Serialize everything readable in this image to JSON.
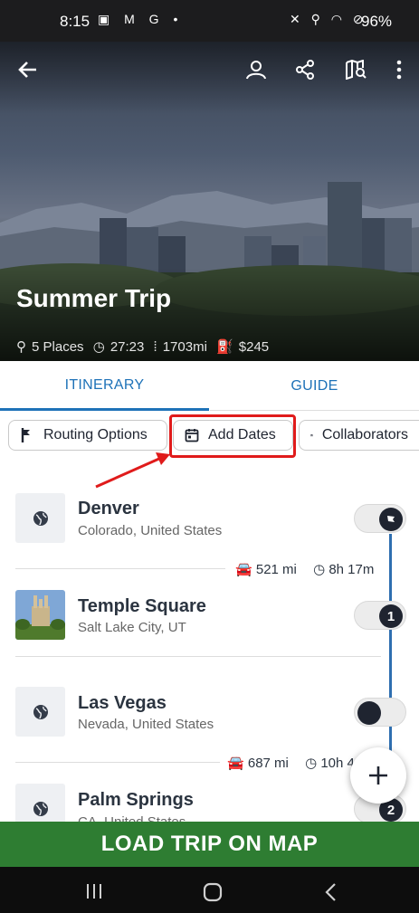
{
  "status_bar": {
    "time": "8:15",
    "left_icons": "▣ M G •",
    "right_icons": "✕ ⚲ ◠ ⊘",
    "battery": "96%"
  },
  "header": {
    "title": "Summer Trip",
    "stats": {
      "places": "5 Places",
      "duration": "27:23",
      "distance": "1703mi",
      "cost": "$245"
    }
  },
  "tabs": [
    {
      "label": "ITINERARY",
      "active": true
    },
    {
      "label": "GUIDE",
      "active": false
    }
  ],
  "chips": {
    "routing": "Routing Options",
    "dates": "Add Dates",
    "collab": "Collaborators"
  },
  "stops": [
    {
      "name": "Denver",
      "sub": "Colorado, United States",
      "marker": "flag"
    },
    {
      "name": "Temple Square",
      "sub": "Salt Lake City, UT",
      "marker": "1"
    },
    {
      "name": "Las Vegas",
      "sub": "Nevada, United States",
      "marker": ""
    },
    {
      "name": "Palm Springs",
      "sub": "CA, United States",
      "marker": "2"
    }
  ],
  "legs": [
    {
      "distance": "521 mi",
      "time": "8h 17m"
    },
    {
      "distance": "687 mi",
      "time": "10h 4"
    }
  ],
  "load_button": "LOAD TRIP ON MAP",
  "colors": {
    "accent": "#1e72b8",
    "route": "#2f6fb0",
    "load": "#2e7d32",
    "highlight": "#e01b1b"
  }
}
